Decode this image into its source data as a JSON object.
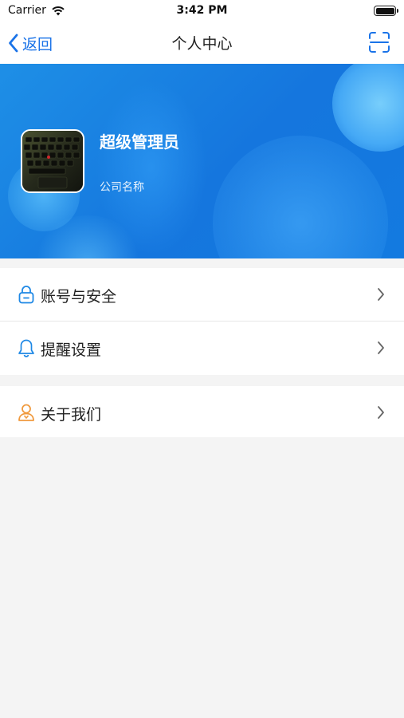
{
  "status_bar": {
    "carrier": "Carrier",
    "time": "3:42 PM",
    "icons": [
      "wifi-icon",
      "battery-icon"
    ]
  },
  "nav": {
    "back_label": "返回",
    "title": "个人中心",
    "icons": [
      "chevron-left-icon",
      "scan-icon"
    ]
  },
  "profile": {
    "name": "超级管理员",
    "company": "公司名称",
    "avatar": "keyboard-photo-avatar"
  },
  "menu": {
    "group1": [
      {
        "label": "账号与安全",
        "icon": "lock-icon"
      },
      {
        "label": "提醒设置",
        "icon": "bell-icon"
      }
    ],
    "group2": [
      {
        "label": "关于我们",
        "icon": "user-icon"
      }
    ]
  },
  "colors": {
    "accent": "#1a73e8",
    "header_blue": "#1576de",
    "icon_orange": "#f09a3e",
    "icon_blue": "#1e88e5",
    "background": "#f4f4f4"
  }
}
